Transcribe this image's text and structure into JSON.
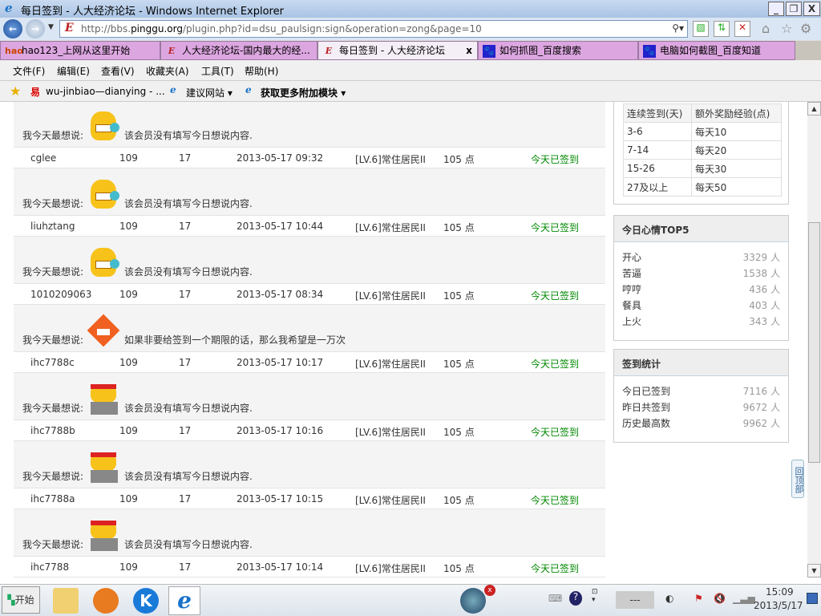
{
  "window": {
    "title": "每日签到 - 人大经济论坛 - Windows Internet Explorer"
  },
  "address": {
    "url_prefix": "http://bbs.",
    "url_domain": "pinggu.org",
    "url_rest": "/plugin.php?id=dsu_paulsign:sign&operation=zong&page=10"
  },
  "tabs": [
    {
      "label": "hao123_上网从这里开始",
      "icon": "hao-icon"
    },
    {
      "label": "人大经济论坛-国内最大的经...",
      "icon": "e-icon"
    },
    {
      "label": "每日签到 - 人大经济论坛",
      "icon": "e-icon",
      "active": true
    },
    {
      "label": "如何抓图_百度搜索",
      "icon": "paw-icon"
    },
    {
      "label": "电脑如何截图_百度知道",
      "icon": "paw-icon"
    }
  ],
  "menu": [
    "文件(F)",
    "编辑(E)",
    "查看(V)",
    "收藏夹(A)",
    "工具(T)",
    "帮助(H)"
  ],
  "favorites": {
    "item1": "wu-jinbiao—dianying - ...",
    "item2": "建议网站",
    "item3": "获取更多附加模块"
  },
  "entries": [
    {
      "say_label": "我今天最想说:",
      "emo": "grin",
      "say": "该会员没有填写今日想说内容.",
      "user": "cglee",
      "total": "109",
      "month": "17",
      "time": "2013-05-17 09:32",
      "level": "[LV.6]常住居民II",
      "reward": "105 点",
      "status": "今天已签到"
    },
    {
      "say_label": "我今天最想说:",
      "emo": "grin",
      "say": "该会员没有填写今日想说内容.",
      "user": "liuhztang",
      "total": "109",
      "month": "17",
      "time": "2013-05-17 10:44",
      "level": "[LV.6]常住居民II",
      "reward": "105 点",
      "status": "今天已签到"
    },
    {
      "say_label": "我今天最想说:",
      "emo": "grin",
      "say": "该会员没有填写今日想说内容.",
      "user": "1010209063",
      "total": "109",
      "month": "17",
      "time": "2013-05-17 08:34",
      "level": "[LV.6]常住居民II",
      "reward": "105 点",
      "status": "今天已签到"
    },
    {
      "say_label": "我今天最想说:",
      "emo": "angry",
      "say": "如果非要给签到一个期限的话，那么我希望是一万次",
      "user": "ihc7788c",
      "total": "109",
      "month": "17",
      "time": "2013-05-17 10:17",
      "level": "[LV.6]常住居民II",
      "reward": "105 点",
      "status": "今天已签到"
    },
    {
      "say_label": "我今天最想说:",
      "emo": "ninja",
      "say": "该会员没有填写今日想说内容.",
      "user": "ihc7788b",
      "total": "109",
      "month": "17",
      "time": "2013-05-17 10:16",
      "level": "[LV.6]常住居民II",
      "reward": "105 点",
      "status": "今天已签到"
    },
    {
      "say_label": "我今天最想说:",
      "emo": "ninja",
      "say": "该会员没有填写今日想说内容.",
      "user": "ihc7788a",
      "total": "109",
      "month": "17",
      "time": "2013-05-17 10:15",
      "level": "[LV.6]常住居民II",
      "reward": "105 点",
      "status": "今天已签到"
    },
    {
      "say_label": "我今天最想说:",
      "emo": "ninja",
      "say": "该会员没有填写今日想说内容.",
      "user": "ihc7788",
      "total": "109",
      "month": "17",
      "time": "2013-05-17 10:14",
      "level": "[LV.6]常住居民II",
      "reward": "105 点",
      "status": "今天已签到"
    }
  ],
  "reward_table": {
    "headers": [
      "连续签到(天)",
      "额外奖励经验(点)"
    ],
    "rows": [
      [
        "3-6",
        "每天10"
      ],
      [
        "7-14",
        "每天20"
      ],
      [
        "15-26",
        "每天30"
      ],
      [
        "27及以上",
        "每天50"
      ]
    ]
  },
  "mood": {
    "title": "今日心情TOP5",
    "items": [
      {
        "k": "开心",
        "v": "3329 人"
      },
      {
        "k": "苦逼",
        "v": "1538 人"
      },
      {
        "k": "哼哼",
        "v": "436 人"
      },
      {
        "k": "餐具",
        "v": "403 人"
      },
      {
        "k": "上火",
        "v": "343 人"
      }
    ]
  },
  "stats": {
    "title": "签到统计",
    "items": [
      {
        "k": "今日已签到",
        "v": "7116 人"
      },
      {
        "k": "昨日共签到",
        "v": "9672 人"
      },
      {
        "k": "历史最高数",
        "v": "9962 人"
      }
    ]
  },
  "back_to_top": "回顶部",
  "taskbar": {
    "start": "开始",
    "clock_time": "15:09",
    "clock_date": "2013/5/17",
    "ime": "---"
  },
  "colors": {
    "green": "#008800",
    "tab": "#dca6e0"
  }
}
